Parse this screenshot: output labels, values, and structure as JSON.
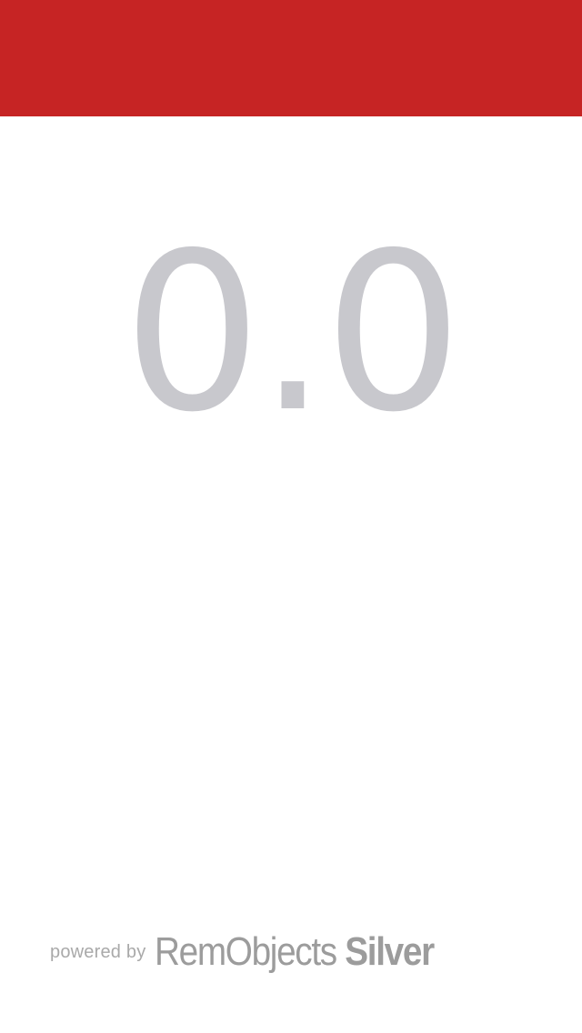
{
  "colors": {
    "top_bar": "#c62424",
    "reading_text": "#c8c8cd",
    "footer_text": "#9c9c9c"
  },
  "display": {
    "value": "0.0"
  },
  "footer": {
    "powered_by": "powered by",
    "brand_name": "RemObjects",
    "brand_product": "Silver"
  }
}
